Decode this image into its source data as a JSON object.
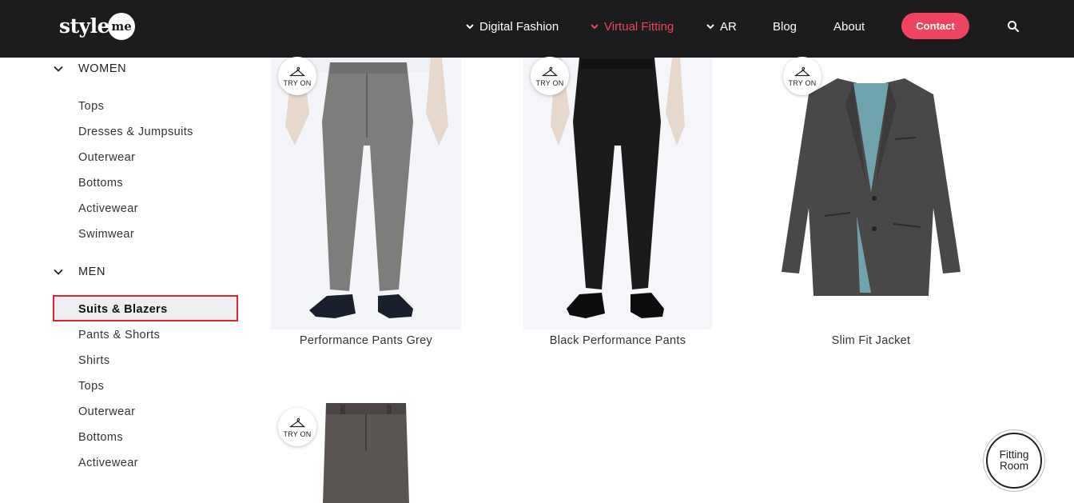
{
  "header": {
    "logo_text": "style",
    "logo_badge": "me",
    "nav": [
      {
        "label": "Digital Fashion",
        "has_chevron": true,
        "active": false
      },
      {
        "label": "Virtual Fitting",
        "has_chevron": true,
        "active": true
      },
      {
        "label": "AR",
        "has_chevron": true,
        "active": false
      },
      {
        "label": "Blog",
        "has_chevron": false,
        "active": false
      },
      {
        "label": "About",
        "has_chevron": false,
        "active": false
      }
    ],
    "contact_label": "Contact",
    "search_icon": "search-icon",
    "colors": {
      "bar": "#1c1c1e",
      "accent": "#ef4460"
    }
  },
  "sidebar": {
    "women": {
      "label": "WOMEN",
      "items": [
        "Tops",
        "Dresses & Jumpsuits",
        "Outerwear",
        "Bottoms",
        "Activewear",
        "Swimwear"
      ]
    },
    "men": {
      "label": "MEN",
      "items": [
        "Suits & Blazers",
        "Pants & Shorts",
        "Shirts",
        "Tops",
        "Outerwear",
        "Bottoms",
        "Activewear"
      ],
      "selected": "Suits & Blazers"
    }
  },
  "products": [
    {
      "name": "Performance Pants Grey",
      "try_on": "TRY ON",
      "color": "#7d7d7b"
    },
    {
      "name": "Black Performance Pants",
      "try_on": "TRY ON",
      "color": "#1b1b1b"
    },
    {
      "name": "Slim Fit Jacket",
      "try_on": "TRY ON",
      "color": "#4a4749"
    },
    {
      "name": "",
      "try_on": "TRY ON",
      "color": "#5a5452"
    }
  ],
  "fitting_room": {
    "line1": "Fitting",
    "line2": "Room"
  }
}
